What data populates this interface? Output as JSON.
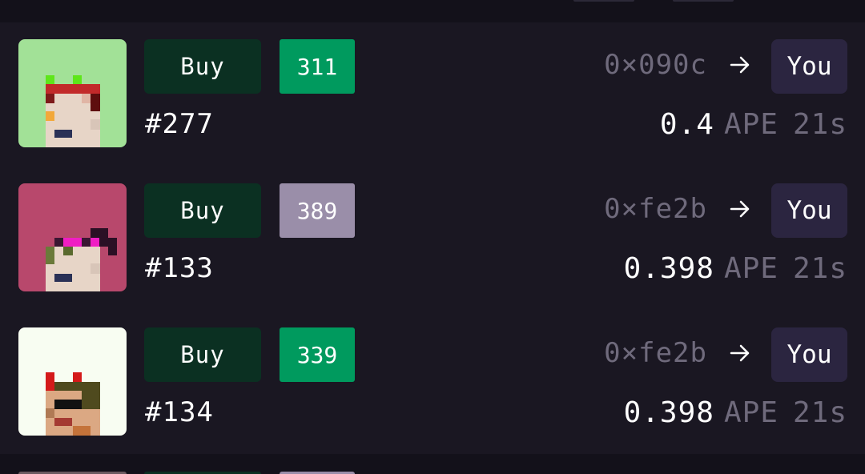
{
  "colors": {
    "background": "#1a1722",
    "buy_button": "#0b3022",
    "rank_green": "#009a5e",
    "rank_purple": "#9a8ea9",
    "you_badge": "#2b2540",
    "muted_text": "#6f6a7c"
  },
  "rows": [
    {
      "thumb_bg": "#a2e197",
      "buy_label": "Buy",
      "rank": "311",
      "rank_style": "green",
      "token_id": "#277",
      "from": "0×090c",
      "arrow_icon": "arrow-right-icon",
      "to": "You",
      "price": "0.4",
      "currency": "APE",
      "age": "21s"
    },
    {
      "thumb_bg": "#b8486c",
      "buy_label": "Buy",
      "rank": "389",
      "rank_style": "purple",
      "token_id": "#133",
      "from": "0×fe2b",
      "arrow_icon": "arrow-right-icon",
      "to": "You",
      "price": "0.398",
      "currency": "APE",
      "age": "21s"
    },
    {
      "thumb_bg": "#f8fdf2",
      "buy_label": "Buy",
      "rank": "339",
      "rank_style": "green",
      "token_id": "#134",
      "from": "0×fe2b",
      "arrow_icon": "arrow-right-icon",
      "to": "You",
      "price": "0.398",
      "currency": "APE",
      "age": "21s"
    }
  ]
}
